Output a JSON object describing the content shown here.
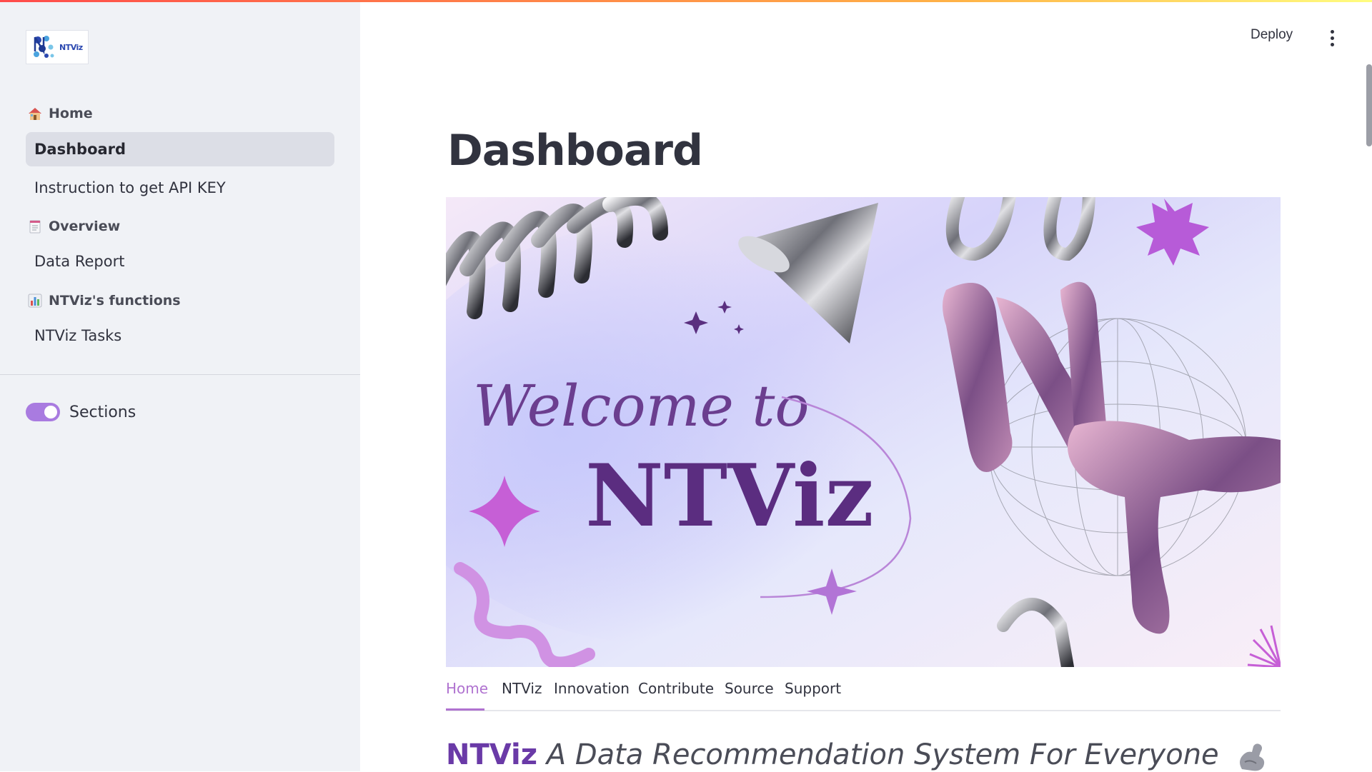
{
  "colors": {
    "accent": "#b073d0",
    "sidebar_bg": "#f0f2f6",
    "active_nav_bg": "#dcdee6",
    "toggle_on": "#a97be0",
    "brand_text": "#6a3aa7"
  },
  "sidebar": {
    "logo_text": "NTViz",
    "sections": [
      {
        "label": "Home",
        "icon": "house-icon",
        "items": [
          {
            "label": "Dashboard",
            "active": true
          },
          {
            "label": "Instruction to get API KEY",
            "active": false
          }
        ]
      },
      {
        "label": "Overview",
        "icon": "notepad-icon",
        "items": [
          {
            "label": "Data Report",
            "active": false
          }
        ]
      },
      {
        "label": "NTViz's functions",
        "icon": "bar-chart-icon",
        "items": [
          {
            "label": "NTViz Tasks",
            "active": false
          }
        ]
      }
    ],
    "toggle": {
      "label": "Sections",
      "on": true
    }
  },
  "header": {
    "deploy_label": "Deploy",
    "menu_icon": "vertical-ellipsis-icon"
  },
  "main": {
    "title": "Dashboard",
    "hero": {
      "welcome_text": "Welcome to",
      "brand_text": "NTViz"
    },
    "tabs": [
      {
        "label": "Home",
        "active": true
      },
      {
        "label": "NTViz",
        "active": false
      },
      {
        "label": "Innovation",
        "active": false
      },
      {
        "label": "Contribute",
        "active": false
      },
      {
        "label": "Source",
        "active": false
      },
      {
        "label": "Support",
        "active": false
      }
    ],
    "subtitle": {
      "brand": "NTViz",
      "tagline": "A Data Recommendation System For Everyone",
      "icon": "flexed-biceps-icon"
    }
  }
}
